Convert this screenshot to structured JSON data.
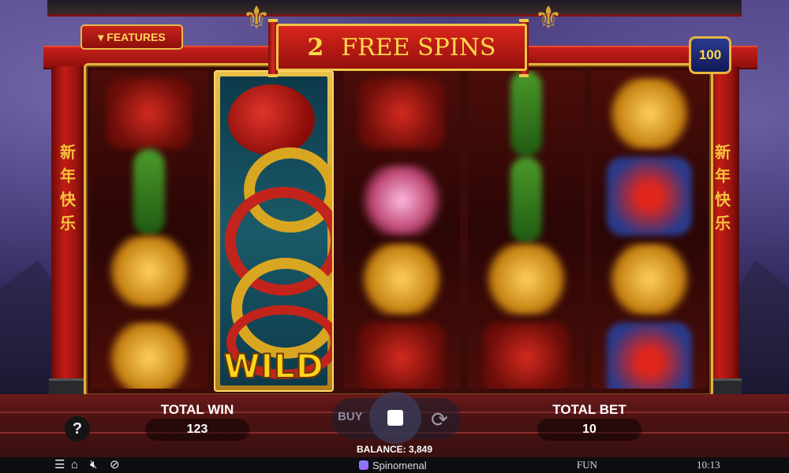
{
  "banner": {
    "count": "2",
    "text": "FREE SPINS"
  },
  "features_button": {
    "label": "FEATURES",
    "icon": "triangle-down-icon"
  },
  "bet_level_badge": {
    "value": "100"
  },
  "pillar_text": {
    "left": "新年快乐",
    "right": "新年快乐"
  },
  "reels": {
    "wild_label": "WILD"
  },
  "total_win": {
    "label": "TOTAL WIN",
    "value": "123"
  },
  "total_bet": {
    "label": "TOTAL BET",
    "value": "10"
  },
  "controls": {
    "buy_label": "BUY",
    "help_label": "?"
  },
  "balance": {
    "text": "BALANCE: 3,849"
  },
  "statusbar": {
    "provider": "Spinomenal",
    "mode": "FUN",
    "time": "10:13",
    "icons": [
      "menu-icon",
      "home-icon",
      "sound-off-icon",
      "turbo-icon"
    ]
  },
  "colors": {
    "frame_red": "#c21d16",
    "gold": "#e4b43b",
    "accent_yellow": "#ffd94a"
  }
}
